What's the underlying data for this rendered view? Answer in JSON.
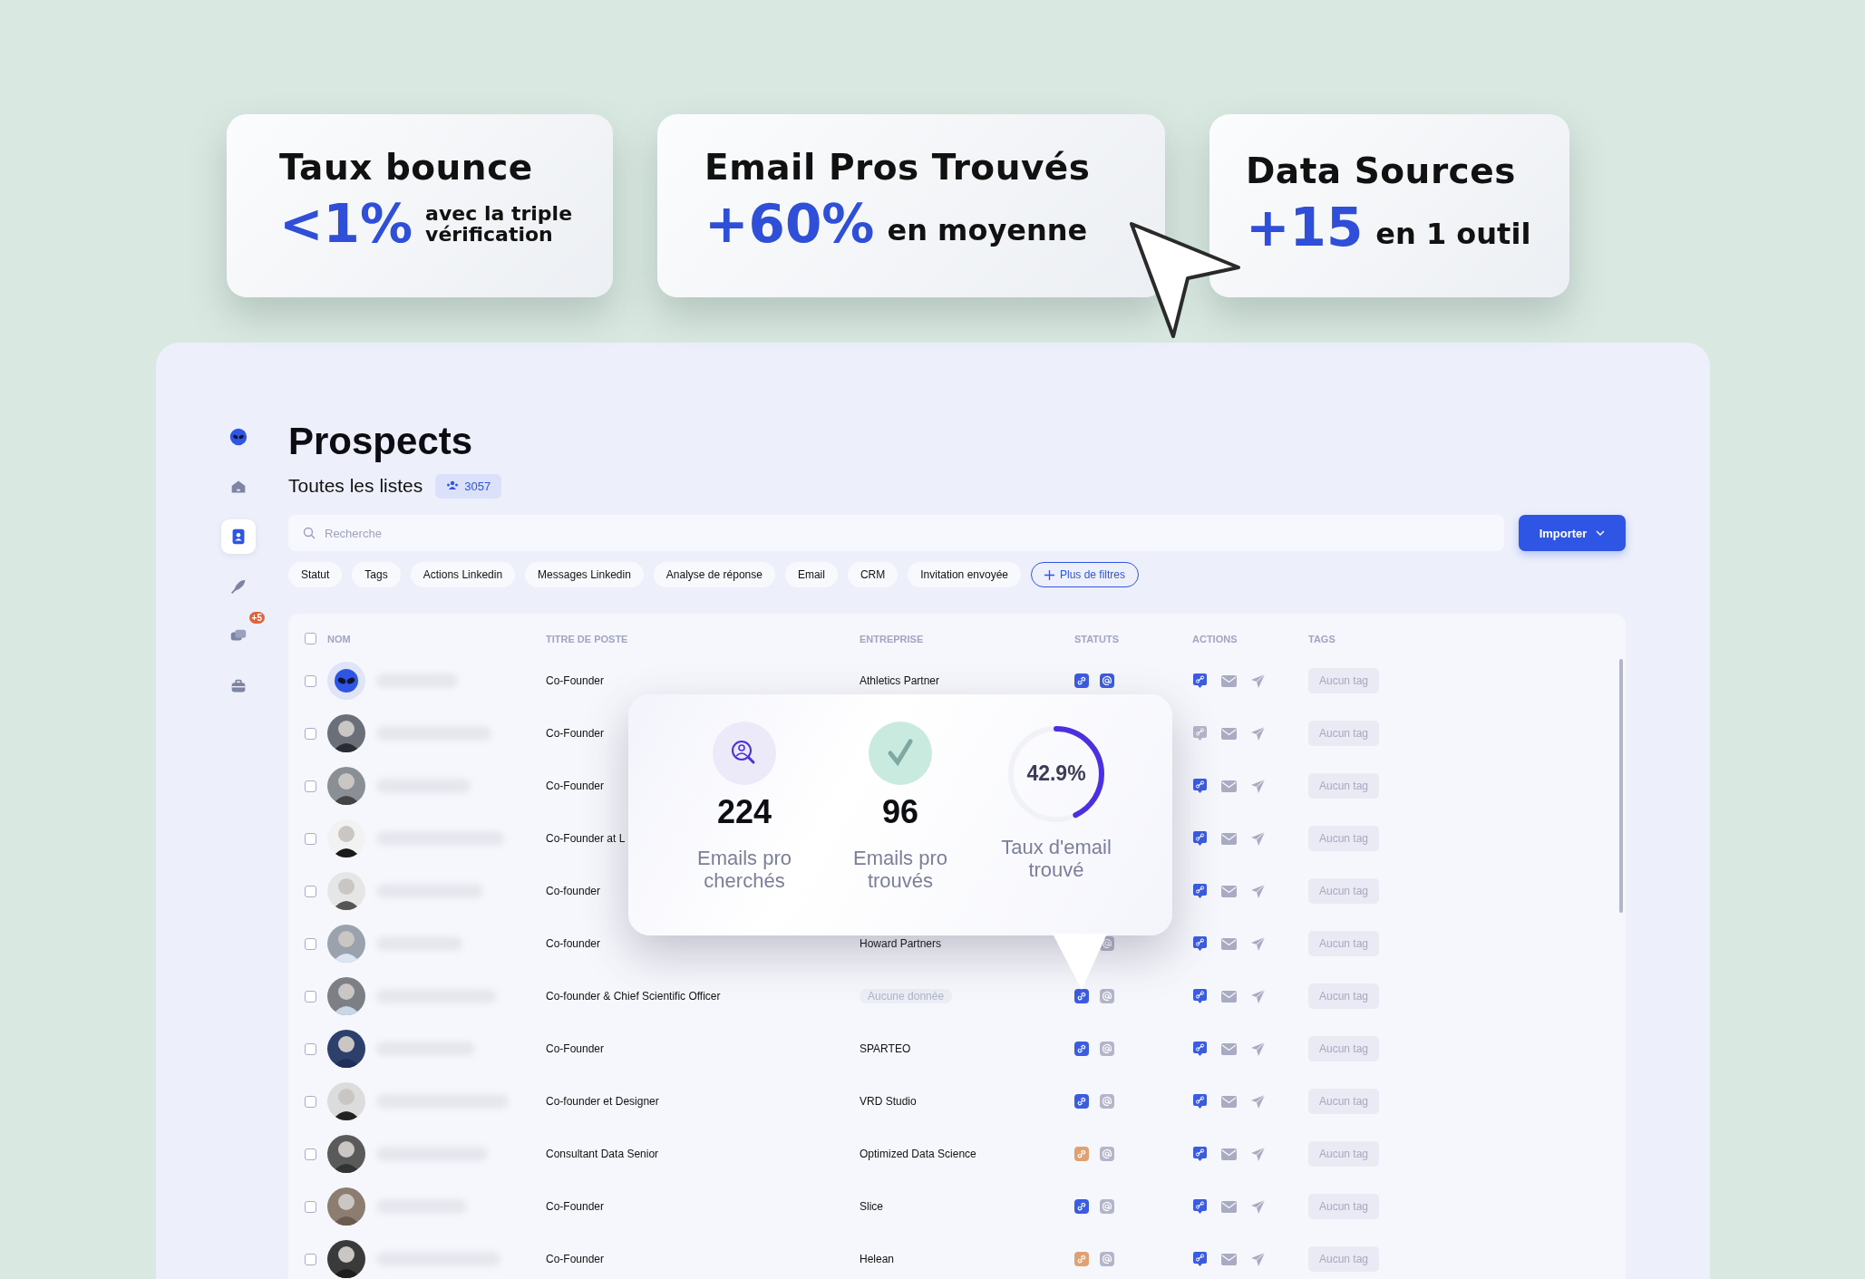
{
  "promo_cards": [
    {
      "title": "Taux bounce",
      "figure": "<1%",
      "caption": "avec la triple vérification"
    },
    {
      "title": "Email Pros Trouvés",
      "figure": "+60%",
      "caption": "en moyenne"
    },
    {
      "title": "Data Sources",
      "figure": "+15",
      "caption": "en 1 outil"
    }
  ],
  "sidebar": {
    "items": [
      {
        "selected": false
      },
      {
        "selected": false
      },
      {
        "selected": true
      },
      {
        "selected": false
      },
      {
        "selected": false,
        "badge": "+5"
      },
      {
        "selected": false
      }
    ]
  },
  "page_title": "Prospects",
  "list_title": "Toutes les listes",
  "list_count": "3057",
  "search": {
    "placeholder": "Recherche"
  },
  "import_button": "Importer",
  "filters": [
    {
      "label": "Statut",
      "kind": "chip"
    },
    {
      "label": "Tags",
      "kind": "chip"
    },
    {
      "label": "Actions Linkedin",
      "kind": "chip"
    },
    {
      "label": "Messages Linkedin",
      "kind": "chip"
    },
    {
      "label": "Analyse de réponse",
      "kind": "chip"
    },
    {
      "label": "Email",
      "kind": "chip"
    },
    {
      "label": "CRM",
      "kind": "chip"
    },
    {
      "label": "Invitation envoyée",
      "kind": "chip"
    },
    {
      "label": "Plus de filtres",
      "kind": "more"
    }
  ],
  "table": {
    "select_all_checked": false,
    "columns": [
      "NOM",
      "TITRE DE POSTE",
      "ENTREPRISE",
      "STATUTS",
      "ACTIONS",
      "TAGS"
    ],
    "rows": [
      {
        "checked": false,
        "title": "Co-Founder",
        "company": {
          "text": "Athletics Partner",
          "kind": "name"
        },
        "statuses": {
          "link": {
            "color": "#3b5be0"
          },
          "email_found": true
        },
        "linkedin_active": true,
        "tag": "Aucun tag"
      },
      {
        "checked": false,
        "title": "Co-Founder",
        "linkedin_active": false,
        "tag": "Aucun tag"
      },
      {
        "checked": false,
        "title": "Co-Founder",
        "linkedin_active": true,
        "tag": "Aucun tag"
      },
      {
        "checked": false,
        "title": "Co-Founder at L",
        "linkedin_active": true,
        "tag": "Aucun tag"
      },
      {
        "checked": false,
        "title": "Co-founder",
        "linkedin_active": true,
        "tag": "Aucun tag"
      },
      {
        "checked": false,
        "title": "Co-founder",
        "company": {
          "text": "Howard Partners",
          "kind": "name"
        },
        "statuses": {
          "email_found": false
        },
        "linkedin_active": true,
        "tag": "Aucun tag"
      },
      {
        "checked": false,
        "title": "Co-founder & Chief Scientific Officer",
        "company": {
          "text": "Aucune donnée",
          "kind": "empty"
        },
        "statuses": {
          "link": {
            "color": "#3b5be0"
          },
          "email_found": false
        },
        "linkedin_active": true,
        "tag": "Aucun tag"
      },
      {
        "checked": false,
        "title": "Co-Founder",
        "company": {
          "text": "SPARTEO",
          "kind": "name"
        },
        "statuses": {
          "link": {
            "color": "#3b5be0"
          },
          "email_found": false
        },
        "linkedin_active": true,
        "tag": "Aucun tag"
      },
      {
        "checked": false,
        "title": "Co-founder et Designer",
        "company": {
          "text": "VRD Studio",
          "kind": "name"
        },
        "statuses": {
          "link": {
            "color": "#3b5be0"
          },
          "email_found": false
        },
        "linkedin_active": true,
        "tag": "Aucun tag"
      },
      {
        "checked": false,
        "title": "Consultant Data Senior",
        "company": {
          "text": "Optimized Data Science",
          "kind": "name"
        },
        "statuses": {
          "link": {
            "color": "#e0a06f"
          },
          "email_found": false
        },
        "linkedin_active": true,
        "tag": "Aucun tag"
      },
      {
        "checked": false,
        "title": "Co-Founder",
        "company": {
          "text": "Slice",
          "kind": "name"
        },
        "statuses": {
          "link": {
            "color": "#3b5be0"
          },
          "email_found": false
        },
        "linkedin_active": true,
        "tag": "Aucun tag"
      },
      {
        "checked": false,
        "title": "Co-Founder",
        "company": {
          "text": "Helean",
          "kind": "name"
        },
        "statuses": {
          "link": {
            "color": "#e0a06f"
          },
          "email_found": false
        },
        "linkedin_active": true,
        "tag": "Aucun tag"
      }
    ]
  },
  "stats_popup": {
    "stats": [
      {
        "kind": "search",
        "value": "224",
        "label": "Emails pro cherchés"
      },
      {
        "kind": "check",
        "value": "96",
        "label": "Emails pro trouvés"
      },
      {
        "kind": "ring",
        "level": 0.429,
        "value": "42.9%",
        "label": "Taux d'email trouvé"
      }
    ]
  }
}
